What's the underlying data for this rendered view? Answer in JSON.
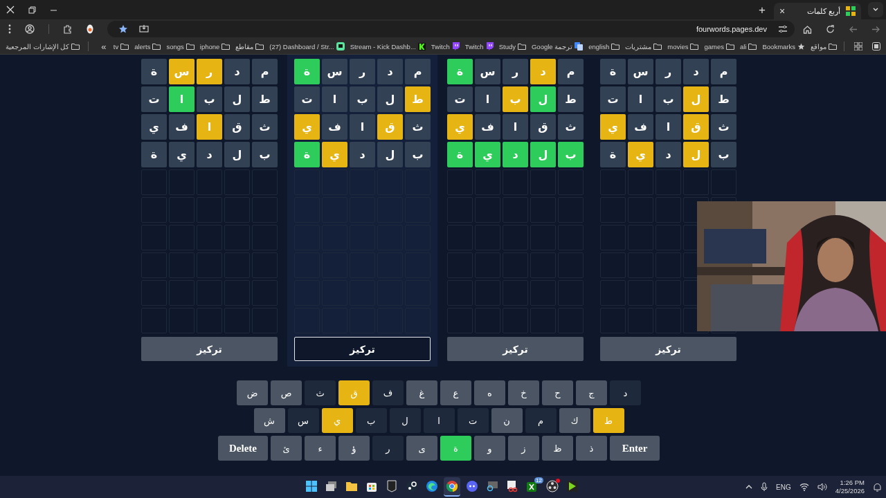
{
  "browser": {
    "tab": {
      "title": "أربع كلمات",
      "close": "×"
    },
    "new_tab": "+",
    "url": "fourwords.pages.dev",
    "bookmarks": [
      {
        "label": "مواقع",
        "kind": "folder"
      },
      {
        "label": "Bookmarks",
        "kind": "star"
      },
      {
        "label": "ali",
        "kind": "folder"
      },
      {
        "label": "games",
        "kind": "folder"
      },
      {
        "label": "movies",
        "kind": "folder"
      },
      {
        "label": "مشتريات",
        "kind": "folder"
      },
      {
        "label": "english",
        "kind": "folder"
      },
      {
        "label": "Google ترجمة",
        "kind": "translate"
      },
      {
        "label": "Study",
        "kind": "folder"
      },
      {
        "label": "Twitch",
        "kind": "twitch"
      },
      {
        "label": "Twitch",
        "kind": "twitch"
      },
      {
        "label": "Stream - Kick Dashb...",
        "kind": "kick"
      },
      {
        "label": "(27) Dashboard / Str...",
        "kind": "dashboard"
      },
      {
        "label": "مقاطع",
        "kind": "folder"
      },
      {
        "label": "iphone",
        "kind": "folder"
      },
      {
        "label": "songs",
        "kind": "folder"
      },
      {
        "label": "alerts",
        "kind": "folder"
      },
      {
        "label": "tv",
        "kind": "folder"
      }
    ],
    "more_bookmarks": "«",
    "all_bookmarks": "كل الإشارات المرجعية"
  },
  "boards": [
    {
      "selected": false,
      "button": "تركيز",
      "rows": [
        [
          {
            "filled": true,
            "letter": "م",
            "color": "#334155"
          },
          {
            "filled": true,
            "letter": "د",
            "color": "#334155"
          },
          {
            "filled": true,
            "letter": "ر",
            "color": "#334155"
          },
          {
            "filled": true,
            "letter": "س",
            "color": "#334155"
          },
          {
            "filled": true,
            "letter": "ة",
            "color": "#334155"
          }
        ],
        [
          {
            "filled": true,
            "letter": "ط",
            "color": "#334155"
          },
          {
            "filled": true,
            "letter": "ل",
            "color": "#e6b514"
          },
          {
            "filled": true,
            "letter": "ب",
            "color": "#334155"
          },
          {
            "filled": true,
            "letter": "ا",
            "color": "#334155"
          },
          {
            "filled": true,
            "letter": "ت",
            "color": "#334155"
          }
        ],
        [
          {
            "filled": true,
            "letter": "ث",
            "color": "#334155"
          },
          {
            "filled": true,
            "letter": "ق",
            "color": "#e6b514"
          },
          {
            "filled": true,
            "letter": "ا",
            "color": "#334155"
          },
          {
            "filled": true,
            "letter": "ف",
            "color": "#334155"
          },
          {
            "filled": true,
            "letter": "ي",
            "color": "#e6b514"
          }
        ],
        [
          {
            "filled": true,
            "letter": "ب",
            "color": "#334155"
          },
          {
            "filled": true,
            "letter": "ل",
            "color": "#e6b514"
          },
          {
            "filled": true,
            "letter": "د",
            "color": "#334155"
          },
          {
            "filled": true,
            "letter": "ي",
            "color": "#e6b514"
          },
          {
            "filled": true,
            "letter": "ة",
            "color": "#334155"
          }
        ],
        [
          {
            "filled": false
          },
          {
            "filled": false
          },
          {
            "filled": false
          },
          {
            "filled": false
          },
          {
            "filled": false
          }
        ],
        [
          {
            "filled": false
          },
          {
            "filled": false
          },
          {
            "filled": false
          },
          {
            "filled": false
          },
          {
            "filled": false
          }
        ],
        [
          {
            "filled": false
          },
          {
            "filled": false
          },
          {
            "filled": false
          },
          {
            "filled": false
          }
        ],
        [
          {
            "filled": false
          },
          {
            "filled": false
          },
          {
            "filled": false
          },
          {
            "filled": false
          }
        ],
        [
          {
            "filled": false
          },
          {
            "filled": false
          },
          {
            "filled": false
          },
          {
            "filled": false
          }
        ],
        [
          {
            "filled": false
          },
          {
            "filled": false
          },
          {
            "filled": false
          },
          {
            "filled": false
          },
          {
            "filled": false
          }
        ]
      ]
    },
    {
      "selected": false,
      "button": "تركيز",
      "rows": [
        [
          {
            "filled": true,
            "letter": "م",
            "color": "#334155"
          },
          {
            "filled": true,
            "letter": "د",
            "color": "#e6b514"
          },
          {
            "filled": true,
            "letter": "ر",
            "color": "#334155"
          },
          {
            "filled": true,
            "letter": "س",
            "color": "#334155"
          },
          {
            "filled": true,
            "letter": "ة",
            "color": "#2ecc5a"
          }
        ],
        [
          {
            "filled": true,
            "letter": "ط",
            "color": "#334155"
          },
          {
            "filled": true,
            "letter": "ل",
            "color": "#2ecc5a"
          },
          {
            "filled": true,
            "letter": "ب",
            "color": "#e6b514"
          },
          {
            "filled": true,
            "letter": "ا",
            "color": "#334155"
          },
          {
            "filled": true,
            "letter": "ت",
            "color": "#334155"
          }
        ],
        [
          {
            "filled": true,
            "letter": "ث",
            "color": "#334155"
          },
          {
            "filled": true,
            "letter": "ق",
            "color": "#334155"
          },
          {
            "filled": true,
            "letter": "ا",
            "color": "#334155"
          },
          {
            "filled": true,
            "letter": "ف",
            "color": "#334155"
          },
          {
            "filled": true,
            "letter": "ي",
            "color": "#e6b514"
          }
        ],
        [
          {
            "filled": true,
            "letter": "ب",
            "color": "#2ecc5a"
          },
          {
            "filled": true,
            "letter": "ل",
            "color": "#2ecc5a"
          },
          {
            "filled": true,
            "letter": "د",
            "color": "#2ecc5a"
          },
          {
            "filled": true,
            "letter": "ي",
            "color": "#2ecc5a"
          },
          {
            "filled": true,
            "letter": "ة",
            "color": "#2ecc5a"
          }
        ],
        [
          {
            "filled": false
          },
          {
            "filled": false
          },
          {
            "filled": false
          },
          {
            "filled": false
          },
          {
            "filled": false
          }
        ],
        [
          {
            "filled": false
          },
          {
            "filled": false
          },
          {
            "filled": false
          },
          {
            "filled": false
          },
          {
            "filled": false
          }
        ],
        [
          {
            "filled": false
          },
          {
            "filled": false
          },
          {
            "filled": false
          },
          {
            "filled": false
          },
          {
            "filled": false
          }
        ],
        [
          {
            "filled": false
          },
          {
            "filled": false
          },
          {
            "filled": false
          },
          {
            "filled": false
          },
          {
            "filled": false
          }
        ],
        [
          {
            "filled": false
          },
          {
            "filled": false
          },
          {
            "filled": false
          },
          {
            "filled": false
          },
          {
            "filled": false
          }
        ],
        [
          {
            "filled": false
          },
          {
            "filled": false
          },
          {
            "filled": false
          },
          {
            "filled": false
          },
          {
            "filled": false
          }
        ]
      ]
    },
    {
      "selected": true,
      "button": "تركيز",
      "rows": [
        [
          {
            "filled": true,
            "letter": "م",
            "color": "#334155"
          },
          {
            "filled": true,
            "letter": "د",
            "color": "#334155"
          },
          {
            "filled": true,
            "letter": "ر",
            "color": "#334155"
          },
          {
            "filled": true,
            "letter": "س",
            "color": "#334155"
          },
          {
            "filled": true,
            "letter": "ة",
            "color": "#2ecc5a"
          }
        ],
        [
          {
            "filled": true,
            "letter": "ط",
            "color": "#e6b514"
          },
          {
            "filled": true,
            "letter": "ل",
            "color": "#334155"
          },
          {
            "filled": true,
            "letter": "ب",
            "color": "#334155"
          },
          {
            "filled": true,
            "letter": "ا",
            "color": "#334155"
          },
          {
            "filled": true,
            "letter": "ت",
            "color": "#334155"
          }
        ],
        [
          {
            "filled": true,
            "letter": "ث",
            "color": "#334155"
          },
          {
            "filled": true,
            "letter": "ق",
            "color": "#e6b514"
          },
          {
            "filled": true,
            "letter": "ا",
            "color": "#334155"
          },
          {
            "filled": true,
            "letter": "ف",
            "color": "#334155"
          },
          {
            "filled": true,
            "letter": "ي",
            "color": "#e6b514"
          }
        ],
        [
          {
            "filled": true,
            "letter": "ب",
            "color": "#334155"
          },
          {
            "filled": true,
            "letter": "ل",
            "color": "#334155"
          },
          {
            "filled": true,
            "letter": "د",
            "color": "#334155"
          },
          {
            "filled": true,
            "letter": "ي",
            "color": "#e6b514"
          },
          {
            "filled": true,
            "letter": "ة",
            "color": "#2ecc5a"
          }
        ],
        [
          {
            "filled": false
          },
          {
            "filled": false
          },
          {
            "filled": false
          },
          {
            "filled": false
          },
          {
            "filled": false
          }
        ],
        [
          {
            "filled": false
          },
          {
            "filled": false
          },
          {
            "filled": false
          },
          {
            "filled": false
          },
          {
            "filled": false
          }
        ],
        [
          {
            "filled": false
          },
          {
            "filled": false
          },
          {
            "filled": false
          },
          {
            "filled": false
          },
          {
            "filled": false
          }
        ],
        [
          {
            "filled": false
          },
          {
            "filled": false
          },
          {
            "filled": false
          },
          {
            "filled": false
          },
          {
            "filled": false
          }
        ],
        [
          {
            "filled": false
          },
          {
            "filled": false
          },
          {
            "filled": false
          },
          {
            "filled": false
          },
          {
            "filled": false
          }
        ],
        [
          {
            "filled": false
          },
          {
            "filled": false
          },
          {
            "filled": false
          },
          {
            "filled": false
          },
          {
            "filled": false
          }
        ]
      ]
    },
    {
      "selected": false,
      "button": "تركيز",
      "rows": [
        [
          {
            "filled": true,
            "letter": "م",
            "color": "#334155"
          },
          {
            "filled": true,
            "letter": "د",
            "color": "#334155"
          },
          {
            "filled": true,
            "letter": "ر",
            "color": "#e6b514"
          },
          {
            "filled": true,
            "letter": "س",
            "color": "#e6b514"
          },
          {
            "filled": true,
            "letter": "ة",
            "color": "#334155"
          }
        ],
        [
          {
            "filled": true,
            "letter": "ط",
            "color": "#334155"
          },
          {
            "filled": true,
            "letter": "ل",
            "color": "#334155"
          },
          {
            "filled": true,
            "letter": "ب",
            "color": "#334155"
          },
          {
            "filled": true,
            "letter": "ا",
            "color": "#2ecc5a"
          },
          {
            "filled": true,
            "letter": "ت",
            "color": "#334155"
          }
        ],
        [
          {
            "filled": true,
            "letter": "ث",
            "color": "#334155"
          },
          {
            "filled": true,
            "letter": "ق",
            "color": "#334155"
          },
          {
            "filled": true,
            "letter": "ا",
            "color": "#e6b514"
          },
          {
            "filled": true,
            "letter": "ف",
            "color": "#334155"
          },
          {
            "filled": true,
            "letter": "ي",
            "color": "#334155"
          }
        ],
        [
          {
            "filled": true,
            "letter": "ب",
            "color": "#334155"
          },
          {
            "filled": true,
            "letter": "ل",
            "color": "#334155"
          },
          {
            "filled": true,
            "letter": "د",
            "color": "#334155"
          },
          {
            "filled": true,
            "letter": "ي",
            "color": "#334155"
          },
          {
            "filled": true,
            "letter": "ة",
            "color": "#334155"
          }
        ],
        [
          {
            "filled": false
          },
          {
            "filled": false
          },
          {
            "filled": false
          },
          {
            "filled": false
          },
          {
            "filled": false
          }
        ],
        [
          {
            "filled": false
          },
          {
            "filled": false
          },
          {
            "filled": false
          },
          {
            "filled": false
          },
          {
            "filled": false
          }
        ],
        [
          {
            "filled": false
          },
          {
            "filled": false
          },
          {
            "filled": false
          },
          {
            "filled": false
          },
          {
            "filled": false
          }
        ],
        [
          {
            "filled": false
          },
          {
            "filled": false
          },
          {
            "filled": false
          },
          {
            "filled": false
          },
          {
            "filled": false
          }
        ],
        [
          {
            "filled": false
          },
          {
            "filled": false
          },
          {
            "filled": false
          },
          {
            "filled": false
          },
          {
            "filled": false
          }
        ],
        [
          {
            "filled": false
          },
          {
            "filled": false
          },
          {
            "filled": false
          },
          {
            "filled": false
          },
          {
            "filled": false
          }
        ]
      ]
    }
  ],
  "keyboard": [
    [
      {
        "label": "د",
        "kind": "letter",
        "color": "#1e293b"
      },
      {
        "label": "ج",
        "kind": "letter",
        "color": "#4b5563"
      },
      {
        "label": "ح",
        "kind": "letter",
        "color": "#4b5563"
      },
      {
        "label": "خ",
        "kind": "letter",
        "color": "#4b5563"
      },
      {
        "label": "ه",
        "kind": "letter",
        "color": "#4b5563"
      },
      {
        "label": "ع",
        "kind": "letter",
        "color": "#4b5563"
      },
      {
        "label": "غ",
        "kind": "letter",
        "color": "#4b5563"
      },
      {
        "label": "ف",
        "kind": "letter",
        "color": "#1e293b"
      },
      {
        "label": "ق",
        "kind": "letter",
        "color": "#e6b514"
      },
      {
        "label": "ث",
        "kind": "letter",
        "color": "#1e293b"
      },
      {
        "label": "ص",
        "kind": "letter",
        "color": "#4b5563"
      },
      {
        "label": "ض",
        "kind": "letter",
        "color": "#4b5563"
      }
    ],
    [
      {
        "label": "ط",
        "kind": "letter",
        "color": "#e6b514"
      },
      {
        "label": "ك",
        "kind": "letter",
        "color": "#4b5563"
      },
      {
        "label": "م",
        "kind": "letter",
        "color": "#1e293b"
      },
      {
        "label": "ن",
        "kind": "letter",
        "color": "#4b5563"
      },
      {
        "label": "ت",
        "kind": "letter",
        "color": "#1e293b"
      },
      {
        "label": "ا",
        "kind": "letter",
        "color": "#1e293b"
      },
      {
        "label": "ل",
        "kind": "letter",
        "color": "#1e293b"
      },
      {
        "label": "ب",
        "kind": "letter",
        "color": "#1e293b"
      },
      {
        "label": "ي",
        "kind": "letter",
        "color": "#e6b514"
      },
      {
        "label": "س",
        "kind": "letter",
        "color": "#1e293b"
      },
      {
        "label": "ش",
        "kind": "letter",
        "color": "#4b5563"
      }
    ],
    [
      {
        "label": "Enter",
        "kind": "action"
      },
      {
        "label": "ذ",
        "kind": "letter",
        "color": "#4b5563"
      },
      {
        "label": "ظ",
        "kind": "letter",
        "color": "#4b5563"
      },
      {
        "label": "ز",
        "kind": "letter",
        "color": "#4b5563"
      },
      {
        "label": "و",
        "kind": "letter",
        "color": "#4b5563"
      },
      {
        "label": "ة",
        "kind": "letter",
        "color": "#2ecc5a"
      },
      {
        "label": "ى",
        "kind": "letter",
        "color": "#4b5563"
      },
      {
        "label": "ر",
        "kind": "letter",
        "color": "#1e293b"
      },
      {
        "label": "ؤ",
        "kind": "letter",
        "color": "#4b5563"
      },
      {
        "label": "ء",
        "kind": "letter",
        "color": "#4b5563"
      },
      {
        "label": "ئ",
        "kind": "letter",
        "color": "#4b5563"
      },
      {
        "label": "Delete",
        "kind": "action"
      }
    ]
  ],
  "webcam": {
    "kind": "picture"
  },
  "taskbar": {
    "apps": [
      {
        "selected": false
      },
      {
        "selected": false
      },
      {
        "selected": false
      },
      {
        "selected": false
      },
      {
        "selected": false
      },
      {
        "selected": false
      },
      {
        "selected": false
      },
      {
        "selected": true
      },
      {
        "selected": false
      },
      {
        "selected": false
      },
      {
        "selected": false
      },
      {
        "selected": false
      },
      {
        "selected": false
      },
      {
        "selected": false
      }
    ],
    "badge": "12",
    "language": "ENG",
    "time": "1:26 PM",
    "date": "4/25/2026"
  }
}
